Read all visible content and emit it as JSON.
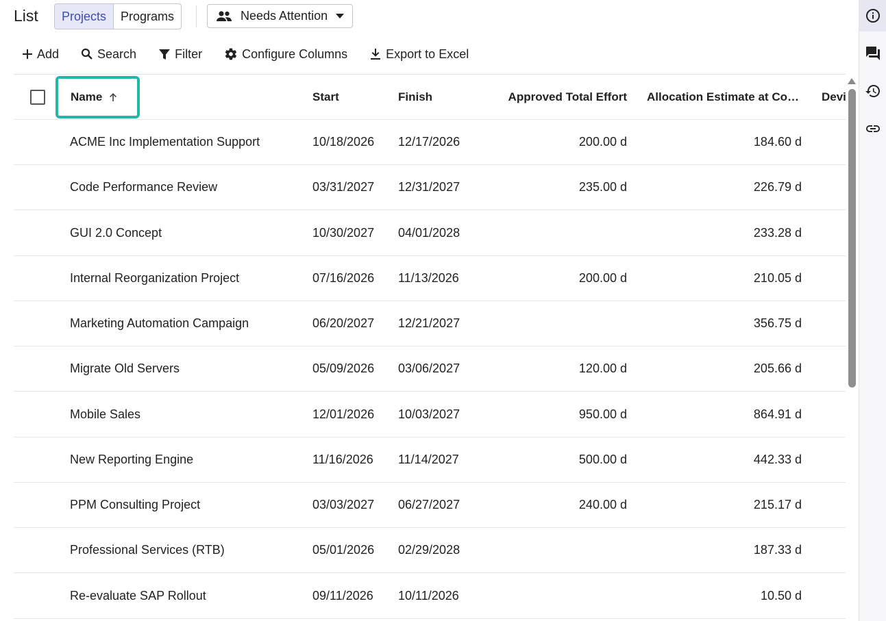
{
  "header": {
    "title": "List",
    "tabs": [
      {
        "label": "Projects",
        "active": true
      },
      {
        "label": "Programs",
        "active": false
      }
    ],
    "view_select": {
      "value": "Needs Attention",
      "icon": "people-icon"
    }
  },
  "toolbar": {
    "add": "Add",
    "search": "Search",
    "filter": "Filter",
    "configure": "Configure Columns",
    "export": "Export to Excel"
  },
  "grid": {
    "columns": {
      "name": "Name",
      "start": "Start",
      "finish": "Finish",
      "effort": "Approved Total Effort",
      "alloc": "Allocation Estimate at Co…",
      "dev": "Devi"
    },
    "sort": {
      "column": "Name",
      "direction": "ascending"
    },
    "rows": [
      {
        "name": "ACME Inc Implementation Support",
        "start": "10/18/2026",
        "finish": "12/17/2026",
        "effort": "200.00 d",
        "alloc": "184.60 d"
      },
      {
        "name": "Code Performance Review",
        "start": "03/31/2027",
        "finish": "12/31/2027",
        "effort": "235.00 d",
        "alloc": "226.79 d"
      },
      {
        "name": "GUI 2.0 Concept",
        "start": "10/30/2027",
        "finish": "04/01/2028",
        "effort": "",
        "alloc": "233.28 d"
      },
      {
        "name": "Internal Reorganization Project",
        "start": "07/16/2026",
        "finish": "11/13/2026",
        "effort": "200.00 d",
        "alloc": "210.05 d"
      },
      {
        "name": "Marketing Automation Campaign",
        "start": "06/20/2027",
        "finish": "12/21/2027",
        "effort": "",
        "alloc": "356.75 d"
      },
      {
        "name": "Migrate Old Servers",
        "start": "05/09/2026",
        "finish": "03/06/2027",
        "effort": "120.00 d",
        "alloc": "205.66 d"
      },
      {
        "name": "Mobile Sales",
        "start": "12/01/2026",
        "finish": "10/03/2027",
        "effort": "950.00 d",
        "alloc": "864.91 d"
      },
      {
        "name": "New Reporting Engine",
        "start": "11/16/2026",
        "finish": "11/14/2027",
        "effort": "500.00 d",
        "alloc": "442.33 d"
      },
      {
        "name": "PPM Consulting Project",
        "start": "03/03/2027",
        "finish": "06/27/2027",
        "effort": "240.00 d",
        "alloc": "215.17 d"
      },
      {
        "name": "Professional Services (RTB)",
        "start": "05/01/2026",
        "finish": "02/29/2028",
        "effort": "",
        "alloc": "187.33 d"
      },
      {
        "name": "Re-evaluate SAP Rollout",
        "start": "09/11/2026",
        "finish": "10/11/2026",
        "effort": "",
        "alloc": "10.50 d"
      }
    ]
  },
  "rail": {
    "items": [
      {
        "icon": "info-icon",
        "active": true
      },
      {
        "icon": "comments-icon",
        "active": false
      },
      {
        "icon": "history-icon",
        "active": false
      },
      {
        "icon": "link-icon",
        "active": false
      }
    ]
  },
  "colors": {
    "accent": "#3d4db7",
    "active_tab_bg": "#e6e8f7",
    "highlight_border": "#22b8a8"
  }
}
